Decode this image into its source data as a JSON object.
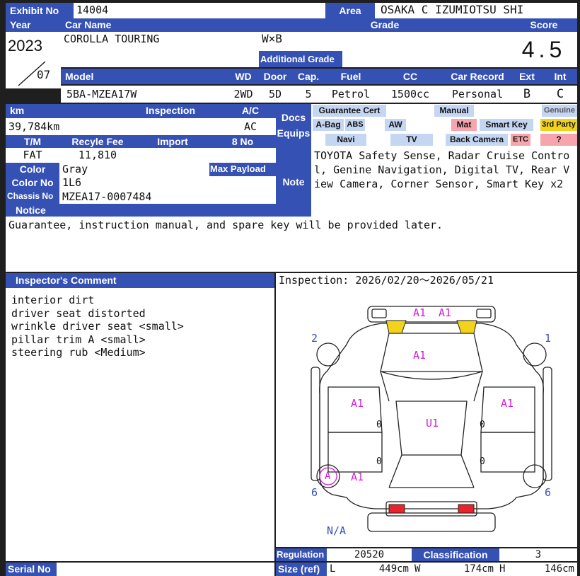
{
  "header": {
    "exhibit_no_label": "Exhibit No",
    "exhibit_no": "14004",
    "area_label": "Area",
    "area": "OSAKA C IZUMIOTSU SHI",
    "year_label": "Year",
    "car_name_label": "Car Name",
    "grade_label": "Grade",
    "score_label": "Score",
    "year": "2023",
    "month": "07",
    "car_name": "COROLLA TOURING",
    "grade": "W×B",
    "additional_grade_label": "Additional Grade",
    "score": "4.5"
  },
  "model_row": {
    "model_label": "Model",
    "wd_label": "WD",
    "door_label": "Door",
    "cap_label": "Cap.",
    "fuel_label": "Fuel",
    "cc_label": "CC",
    "car_record_label": "Car Record",
    "ext_label": "Ext",
    "int_label": "Int",
    "model": "5BA-MZEA17W",
    "wd": "2WD",
    "door": "5D",
    "cap": "5",
    "fuel": "Petrol",
    "cc": "1500cc",
    "car_record": "Personal",
    "ext": "B",
    "int": "C"
  },
  "details": {
    "km_label": "km",
    "inspection_label": "Inspection",
    "ac_label": "A/C",
    "km": "39,784km",
    "ac": "AC",
    "tm_label": "T/M",
    "recycle_fee_label": "Recyle Fee",
    "import_label": "Import",
    "no_label": "8 No",
    "tm": "FAT",
    "recycle_fee": "11,810",
    "color_label": "Color",
    "color": "Gray",
    "max_payload_label": "Max Payload",
    "color_no_label": "Color No",
    "color_no": "1L6",
    "chassis_no_label": "Chassis No",
    "chassis_no": "MZEA17-0007484",
    "docs_label": "Docs",
    "equips_label": "Equips",
    "note_label": "Note",
    "note": "TOYOTA Safety Sense, Radar Cruise Control, Genine Navigation, Digital TV, Rear View Camera, Corner Sensor, Smart Key x2"
  },
  "equipment": {
    "guarantee_cert": "Guarantee Cert",
    "manual": "Manual",
    "genuine": "Genuine",
    "abag": "A-Bag",
    "abs": "ABS",
    "aw": "AW",
    "mat": "Mat",
    "smart_key": "Smart Key",
    "third_party": "3rd Party",
    "navi": "Navi",
    "tv": "TV",
    "back_camera": "Back Camera",
    "etc": "ETC",
    "question": "?"
  },
  "notice": {
    "label": "Notice",
    "text": "Guarantee, instruction manual, and spare key will be provided later."
  },
  "inspector": {
    "label": "Inspector's Comment",
    "comments": [
      "interior dirt",
      "driver seat distorted",
      "wrinkle driver seat <small>",
      "pillar trim A <small>",
      "steering rub <Medium>"
    ]
  },
  "inspection": {
    "text": "Inspection: 2026/02/20〜2026/05/21"
  },
  "diagram": {
    "marks": {
      "front_a1_left": "A1",
      "front_a1_right": "A1",
      "hood": "A1",
      "left_door": "A1",
      "right_door": "A1",
      "roof": "U1",
      "rear_left_circle": "A",
      "rear_left": "A1",
      "zero_1": "0",
      "zero_2": "0",
      "zero_3": "0",
      "zero_4": "0"
    },
    "tire_labels": {
      "front_left": "2",
      "front_right": "1",
      "rear_left": "6",
      "rear_right": "6"
    },
    "na": "N/A"
  },
  "footer": {
    "regulation_label": "Regulation",
    "regulation": "20520",
    "classification_label": "Classification",
    "classification": "3",
    "size_label": "Size (ref)",
    "l_label": "L",
    "l": "449cm",
    "w_label": "W",
    "w": "174cm",
    "h_label": "H",
    "h": "146cm",
    "serial_no_label": "Serial No"
  },
  "colors": {
    "header_blue": "#3551b3",
    "mark_magenta": "#d21fd2",
    "yellow": "#f2d319",
    "red": "#e8232b",
    "pink": "#f6a4ad"
  }
}
